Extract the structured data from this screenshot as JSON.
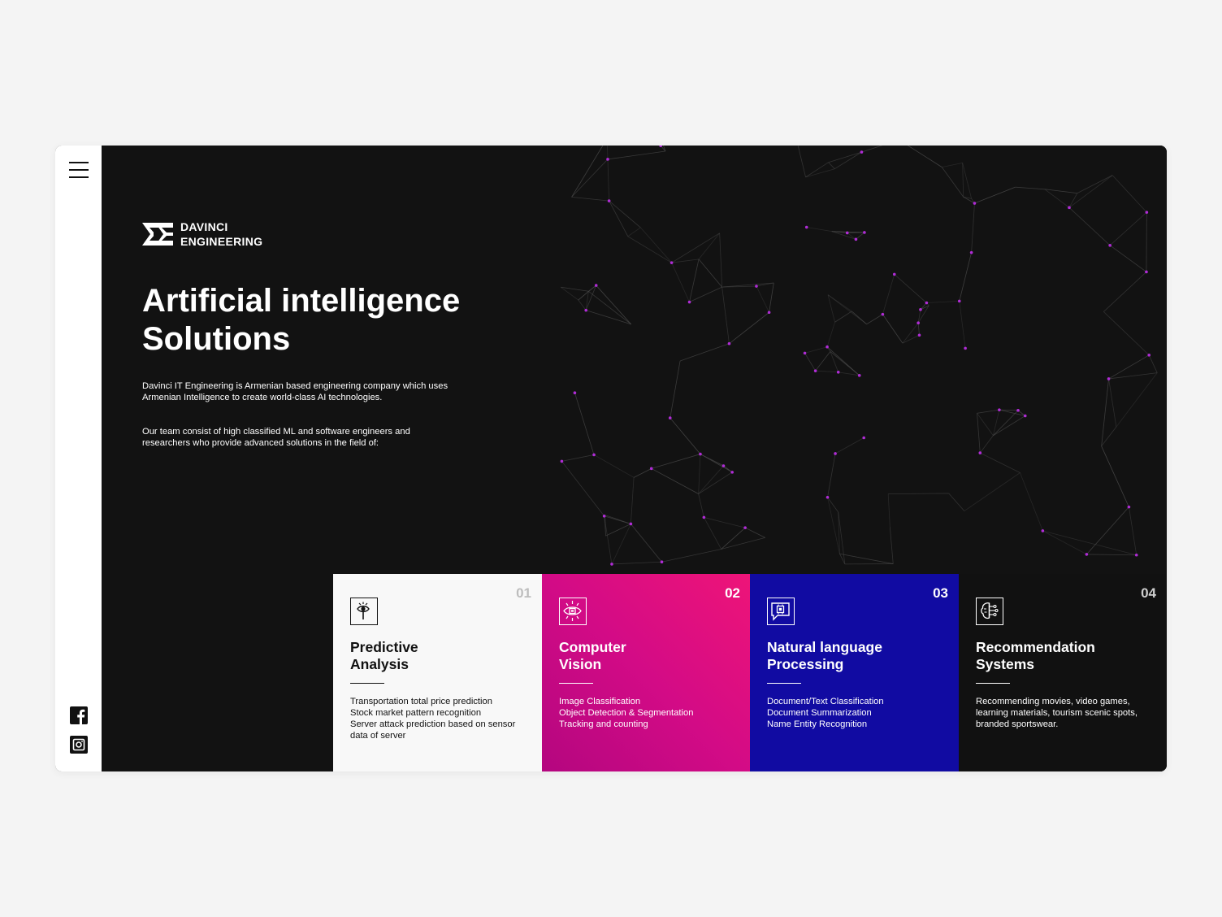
{
  "sidebar": {
    "menu_icon": "hamburger-menu-icon",
    "social": [
      {
        "name": "facebook",
        "icon": "facebook-icon"
      },
      {
        "name": "instagram",
        "icon": "instagram-icon"
      }
    ]
  },
  "brand": {
    "line1": "DAVINCI",
    "line2": "ENGINEERING",
    "logo_icon": "davinci-logo-icon"
  },
  "hero": {
    "title_line1": "Artificial intelligence",
    "title_line2": "Solutions",
    "paragraph1": "Davinci IT Engineering is Armenian based engineering company which uses Armenian Intelligence to create world-class AI technologies.",
    "paragraph2": "Our team consist of high classified ML and software engineers and researchers who provide advanced solutions in the field of:"
  },
  "background": {
    "graphic": "network-mesh",
    "node_color": "#b02cd6",
    "line_color": "#4a4a4a"
  },
  "services": [
    {
      "number": "01",
      "title_line1": "Predictive",
      "title_line2": "Analysis",
      "icon": "eye-magnifier-icon",
      "items": [
        "Transportation total price prediction",
        "Stock market pattern recognition",
        "Server attack prediction based on sensor data of server"
      ]
    },
    {
      "number": "02",
      "title_line1": "Computer",
      "title_line2": "Vision",
      "icon": "vision-chip-icon",
      "items": [
        "Image Classification",
        "Object Detection & Segmentation",
        "Tracking and counting"
      ]
    },
    {
      "number": "03",
      "title_line1": "Natural language",
      "title_line2": "Processing",
      "icon": "chat-chip-icon",
      "items": [
        "Document/Text Classification",
        "Document Summarization",
        "Name Entity Recognition"
      ]
    },
    {
      "number": "04",
      "title_line1": "Recommendation",
      "title_line2": "Systems",
      "icon": "brain-circuit-icon",
      "items": [
        "Recommending movies, video games, learning materials, tourism scenic spots, branded sportswear."
      ]
    }
  ],
  "colors": {
    "page_bg": "#f4f4f4",
    "panel_bg": "#121212",
    "card1_bg": "#f8f8f8",
    "card2_gradient": [
      "#b4067f",
      "#ee1478"
    ],
    "card3_bg": "#110ba2",
    "card4_bg": "#111111"
  }
}
